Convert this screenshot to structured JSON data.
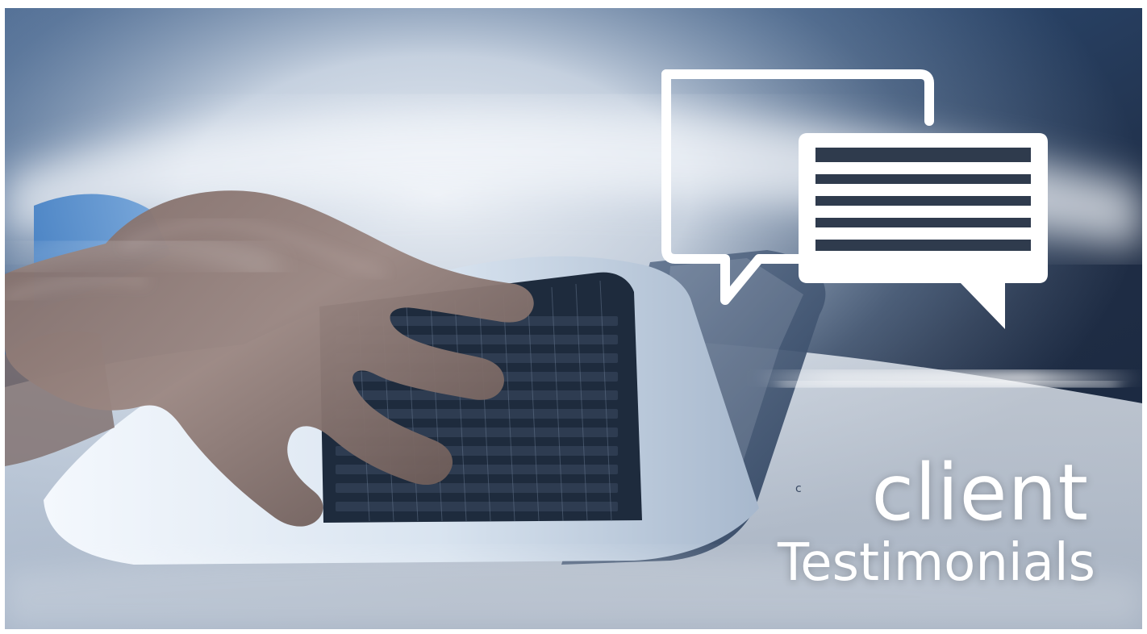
{
  "hero": {
    "title_line1": "client",
    "title_line2": "Testimonials",
    "stray_char": "c"
  },
  "icon_names": [
    "speech-bubble-icon",
    "chat-bubble-icon"
  ],
  "colors": {
    "background_dark": "#1f3552",
    "background_mid": "#4b6586",
    "laptop_light": "#dfe8f3",
    "text": "#ffffff"
  }
}
